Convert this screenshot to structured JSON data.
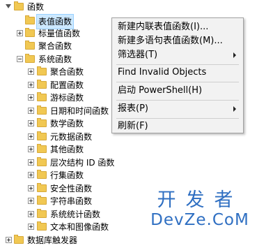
{
  "tree": {
    "items": [
      {
        "label": "函数",
        "expander": "tri"
      },
      {
        "label": "表值函数",
        "expander": "none",
        "selected": true
      },
      {
        "label": "标量值函数",
        "expander": "plus"
      },
      {
        "label": "聚合函数",
        "expander": "none"
      },
      {
        "label": "系统函数",
        "expander": "minus"
      },
      {
        "label": "聚合函数",
        "expander": "plus"
      },
      {
        "label": "配置函数",
        "expander": "plus"
      },
      {
        "label": "游标函数",
        "expander": "plus"
      },
      {
        "label": "日期和时间函数",
        "expander": "plus"
      },
      {
        "label": "数学函数",
        "expander": "plus"
      },
      {
        "label": "元数据函数",
        "expander": "plus"
      },
      {
        "label": "其他函数",
        "expander": "plus"
      },
      {
        "label": "层次结构 ID 函数",
        "expander": "plus"
      },
      {
        "label": "行集函数",
        "expander": "plus"
      },
      {
        "label": "安全性函数",
        "expander": "plus"
      },
      {
        "label": "字符串函数",
        "expander": "plus"
      },
      {
        "label": "系统统计函数",
        "expander": "plus"
      },
      {
        "label": "文本和图像函数",
        "expander": "plus"
      },
      {
        "label": "数据库触发器",
        "expander": "plus"
      }
    ]
  },
  "context_menu": {
    "new_inline_table_function": "新建内联表值函数(I)...",
    "new_multi_statement_table_function": "新建多语句表值函数(M)...",
    "filter": "筛选器(T)",
    "find_invalid_objects": "Find Invalid Objects",
    "start_powershell": "启动 PowerShell(H)",
    "reports": "报表(P)",
    "refresh": "刷新(F)"
  },
  "watermark": {
    "line1": "开发者",
    "line2": "DevZe.CoM"
  }
}
